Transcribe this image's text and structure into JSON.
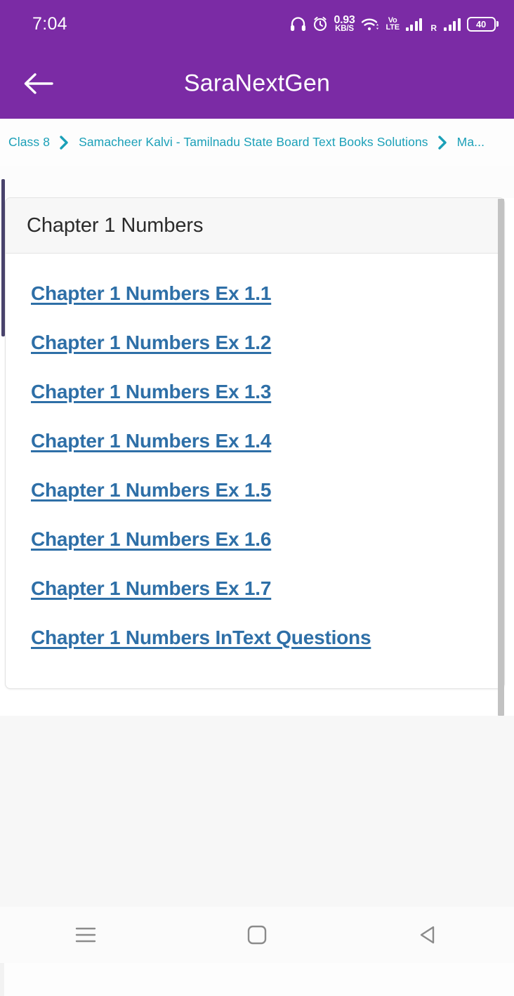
{
  "status_bar": {
    "clock": "7:04",
    "network_speed_value": "0.93",
    "network_speed_unit": "KB/S",
    "volte_top": "Vo",
    "volte_bottom": "LTE",
    "roaming_letter": "R",
    "battery_percent": "40",
    "icons": [
      "headphone-icon",
      "alarm-clock-icon",
      "network-speed-icon",
      "wifi-icon",
      "volte-icon",
      "signal-bars-icon",
      "roaming-signal-bars-icon",
      "battery-icon"
    ]
  },
  "app_bar": {
    "back_icon": "back-arrow-icon",
    "title": "SaraNextGen"
  },
  "breadcrumb": {
    "separator_icon": "chevron-right-icon",
    "items": [
      {
        "label": "Class 8"
      },
      {
        "label": "Samacheer Kalvi - Tamilnadu State Board Text Books Solutions"
      },
      {
        "label": "Ma..."
      }
    ]
  },
  "card": {
    "header_title": "Chapter 1 Numbers",
    "links": [
      {
        "label": "Chapter 1 Numbers Ex 1.1"
      },
      {
        "label": "Chapter 1 Numbers Ex 1.2"
      },
      {
        "label": "Chapter 1 Numbers Ex 1.3"
      },
      {
        "label": "Chapter 1 Numbers Ex 1.4"
      },
      {
        "label": "Chapter 1 Numbers Ex 1.5"
      },
      {
        "label": "Chapter 1 Numbers Ex 1.6"
      },
      {
        "label": "Chapter 1 Numbers Ex 1.7"
      },
      {
        "label": "Chapter 1 Numbers InText Questions"
      }
    ]
  },
  "nav_bar": {
    "recents_icon": "recents-menu-icon",
    "home_icon": "home-square-icon",
    "back_icon": "back-triangle-icon"
  },
  "colors": {
    "brand_purple": "#7B2BA5",
    "breadcrumb_teal": "#1BA0B8",
    "link_blue": "#2E6FA7",
    "card_header_bg": "#F7F7F7",
    "scrollbar_gray": "#C2C2C2",
    "left_scrollbar_navy": "#3A3360"
  }
}
